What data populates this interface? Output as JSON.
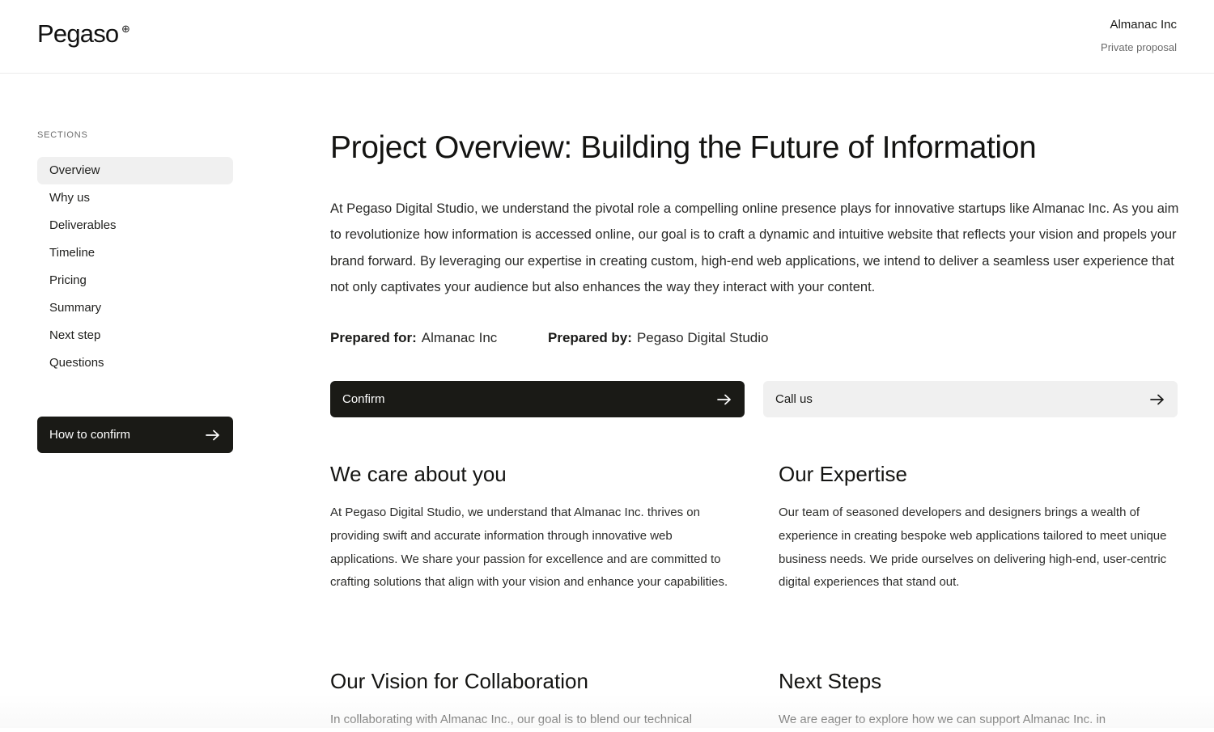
{
  "header": {
    "logo": "Pegaso",
    "logo_mark": "⊕",
    "client_name": "Almanac Inc",
    "client_subtitle": "Private proposal"
  },
  "sidebar": {
    "sections_label": "SECTIONS",
    "items": [
      {
        "label": "Overview",
        "active": true
      },
      {
        "label": "Why us"
      },
      {
        "label": "Deliverables"
      },
      {
        "label": "Timeline"
      },
      {
        "label": "Pricing"
      },
      {
        "label": "Summary"
      },
      {
        "label": "Next step"
      },
      {
        "label": "Questions"
      }
    ],
    "confirm_button": "How to confirm",
    "confirm_icon": "arrow-right-icon"
  },
  "main": {
    "title": "Project Overview: Building the Future of Information",
    "intro": "At Pegaso Digital Studio, we understand the pivotal role a compelling online presence plays for innovative startups like Almanac Inc. As you aim to revolutionize how information is accessed online, our goal is to craft a dynamic and intuitive website that reflects your vision and propels your brand forward. By leveraging our expertise in creating custom, high-end web applications, we intend to deliver a seamless user experience that not only captivates your audience but also enhances the way they interact with your content.",
    "prepared_for_label": "Prepared for:",
    "prepared_for_value": "Almanac Inc",
    "prepared_by_label": "Prepared by:",
    "prepared_by_value": "Pegaso Digital Studio",
    "confirm_button": "Confirm",
    "call_button": "Call us",
    "sections": [
      {
        "title": "We care about you",
        "body": "At Pegaso Digital Studio, we understand that Almanac Inc. thrives on providing swift and accurate information through innovative web applications. We share your passion for excellence and are committed to crafting solutions that align with your vision and enhance your capabilities."
      },
      {
        "title": "Our Expertise",
        "body": "Our team of seasoned developers and designers brings a wealth of experience in creating bespoke web applications tailored to meet unique business needs. We pride ourselves on delivering high-end, user-centric digital experiences that stand out."
      },
      {
        "title": "Our Vision for Collaboration",
        "body": "In collaborating with Almanac Inc., our goal is to blend our technical"
      },
      {
        "title": "Next Steps",
        "body": "We are eager to explore how we can support Almanac Inc. in"
      }
    ]
  },
  "colors": {
    "dark_button": "#1a1a16",
    "light_button": "#f0f0f0",
    "active_nav": "#f0f0f0"
  }
}
